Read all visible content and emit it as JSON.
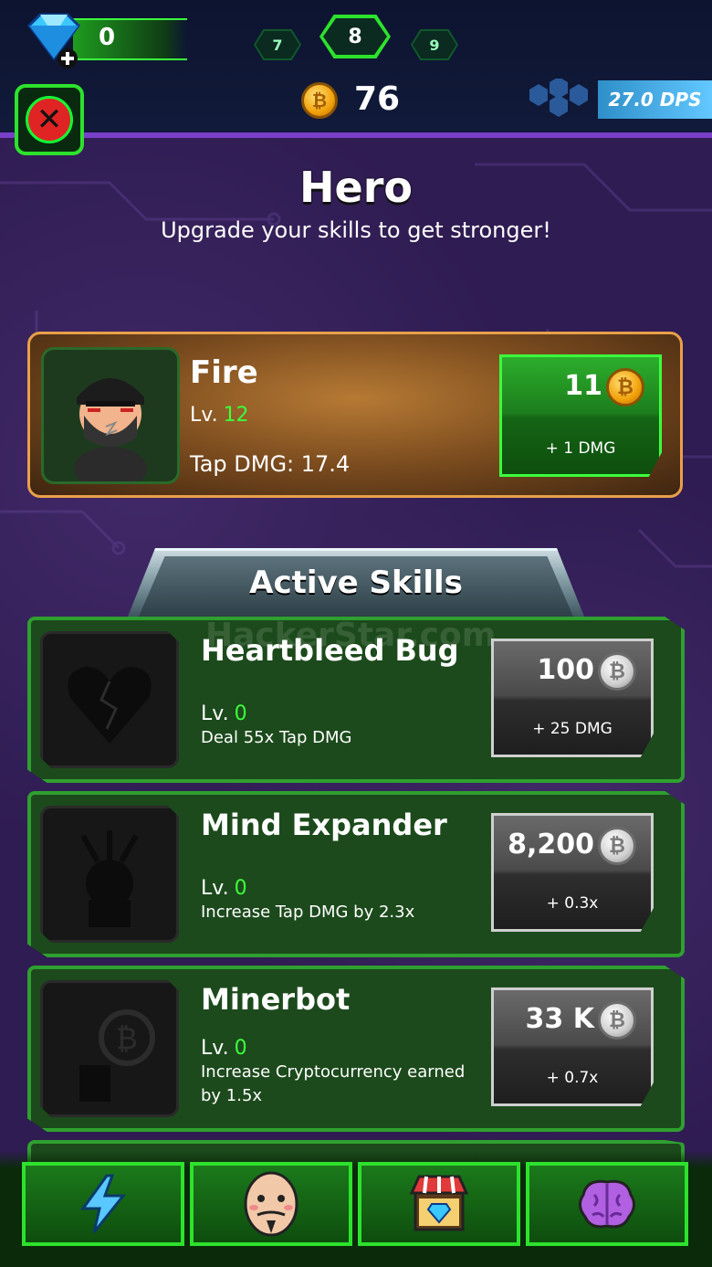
{
  "header": {
    "gems": "0",
    "stages": [
      "7",
      "8",
      "9"
    ],
    "current_stage": "8",
    "coins": "76",
    "dps": "27.0 DPS"
  },
  "page": {
    "title": "Hero",
    "subtitle": "Upgrade your skills to get stronger!"
  },
  "hero": {
    "name": "Fire",
    "level_label": "Lv.",
    "level": "12",
    "tap_dmg": "Tap DMG: 17.4",
    "upgrade_cost": "11",
    "upgrade_bonus": "+ 1 DMG"
  },
  "skills_section": {
    "title": "Active Skills",
    "watermark": "HackerStar.com"
  },
  "skills": [
    {
      "name": "Heartbleed Bug",
      "level_label": "Lv.",
      "level": "0",
      "description": "Deal 55x Tap DMG",
      "cost": "100",
      "bonus": "+ 25 DMG"
    },
    {
      "name": "Mind Expander",
      "level_label": "Lv.",
      "level": "0",
      "description": "Increase Tap DMG by 2.3x",
      "cost": "8,200",
      "bonus": "+ 0.3x"
    },
    {
      "name": "Minerbot",
      "level_label": "Lv.",
      "level": "0",
      "description": "Increase Cryptocurrency earned by 1.5x",
      "cost": "33 K",
      "bonus": "+ 0.7x"
    }
  ],
  "nav": {
    "items": [
      {
        "icon": "lightning-icon"
      },
      {
        "icon": "hero-face-icon"
      },
      {
        "icon": "shop-icon"
      },
      {
        "icon": "brain-icon"
      }
    ]
  },
  "colors": {
    "accent_green": "#3cff3c",
    "background_purple": "#2f1c52",
    "hero_card_border": "#e8a04a",
    "dps_blue": "#2e8fc9"
  }
}
